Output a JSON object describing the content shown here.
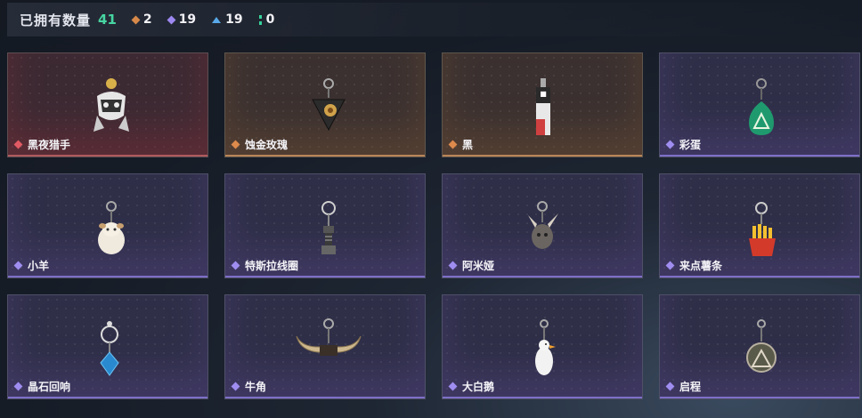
{
  "header": {
    "owned_label": "已拥有数量",
    "owned_count": "41",
    "stats": [
      {
        "icon": "orange-diamond-icon",
        "value": "2"
      },
      {
        "icon": "purple-diamond-icon",
        "value": "19"
      },
      {
        "icon": "blue-triangle-icon",
        "value": "19"
      },
      {
        "icon": "green-bar-icon",
        "value": "0"
      }
    ]
  },
  "items": [
    {
      "name": "黑夜猎手",
      "rarity": "red",
      "icon": "night-hunter-charm-icon"
    },
    {
      "name": "蚀金玫瑰",
      "rarity": "orange",
      "icon": "gilded-rose-charm-icon"
    },
    {
      "name": "黑",
      "rarity": "orange",
      "icon": "black-tag-charm-icon"
    },
    {
      "name": "彩蛋",
      "rarity": "purple",
      "icon": "easter-egg-charm-icon"
    },
    {
      "name": "小羊",
      "rarity": "purple",
      "icon": "lamb-charm-icon"
    },
    {
      "name": "特斯拉线圈",
      "rarity": "purple",
      "icon": "tesla-coil-charm-icon"
    },
    {
      "name": "阿米娅",
      "rarity": "purple",
      "icon": "amiya-charm-icon"
    },
    {
      "name": "来点薯条",
      "rarity": "purple",
      "icon": "fries-charm-icon"
    },
    {
      "name": "晶石回响",
      "rarity": "purple",
      "icon": "crystal-echo-charm-icon"
    },
    {
      "name": "牛角",
      "rarity": "purple",
      "icon": "bull-horn-charm-icon"
    },
    {
      "name": "大白鹅",
      "rarity": "purple",
      "icon": "white-goose-charm-icon"
    },
    {
      "name": "启程",
      "rarity": "purple",
      "icon": "journey-charm-icon"
    }
  ]
}
